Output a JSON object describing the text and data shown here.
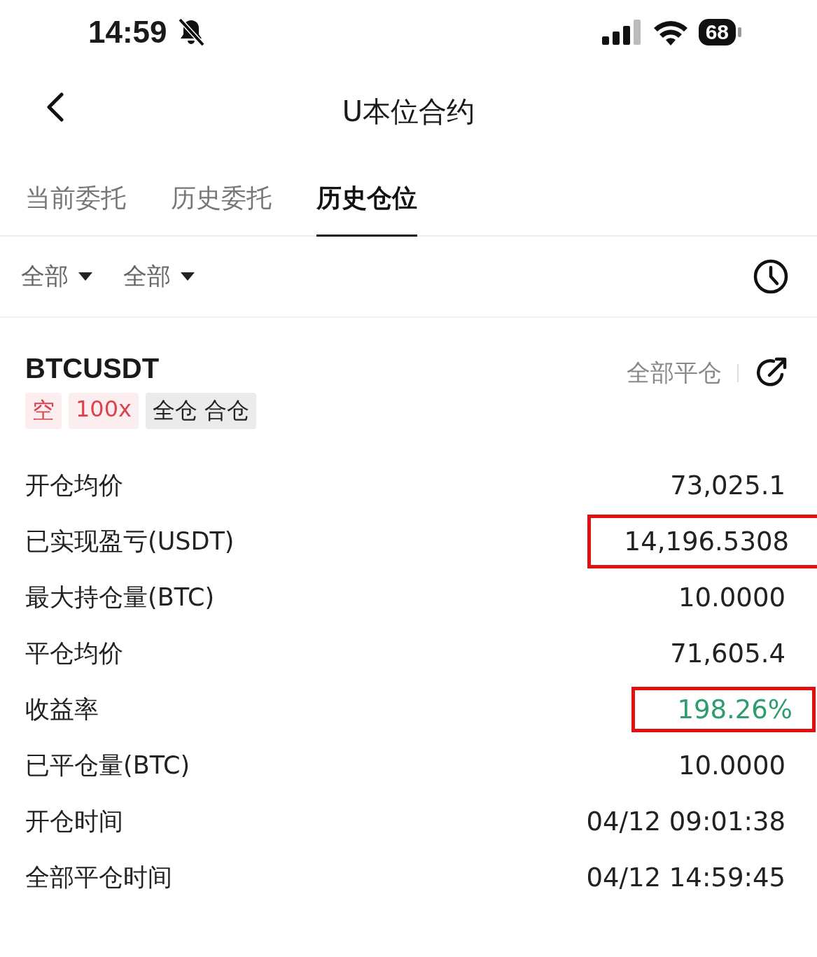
{
  "status_bar": {
    "time": "14:59",
    "battery": "68"
  },
  "header": {
    "title": "U本位合约"
  },
  "tabs": [
    {
      "label": "当前委托",
      "selected": false
    },
    {
      "label": "历史委托",
      "selected": false
    },
    {
      "label": "历史仓位",
      "selected": true
    }
  ],
  "filters": [
    {
      "label": "全部"
    },
    {
      "label": "全部"
    }
  ],
  "position": {
    "symbol": "BTCUSDT",
    "close_all": "全部平仓",
    "tags": [
      {
        "label": "空",
        "color": "#d9434f"
      },
      {
        "label": "100x",
        "color": "#d9434f"
      },
      {
        "label": "全仓 合仓",
        "color": "#222222"
      }
    ],
    "rows": [
      {
        "label": "开仓均价",
        "value": "73,025.1",
        "highlighted": false,
        "positive": false
      },
      {
        "label": "已实现盈亏(USDT)",
        "value": "14,196.5308",
        "highlighted": true,
        "positive": false
      },
      {
        "label": "最大持仓量(BTC)",
        "value": "10.0000",
        "highlighted": false,
        "positive": false
      },
      {
        "label": "平仓均价",
        "value": "71,605.4",
        "highlighted": false,
        "positive": false
      },
      {
        "label": "收益率",
        "value": "198.26%",
        "highlighted": true,
        "positive": true
      },
      {
        "label": "已平仓量(BTC)",
        "value": "10.0000",
        "highlighted": false,
        "positive": false
      },
      {
        "label": "开仓时间",
        "value": "04/12 09:01:38",
        "highlighted": false,
        "positive": false
      },
      {
        "label": "全部平仓时间",
        "value": "04/12 14:59:45",
        "highlighted": false,
        "positive": false
      }
    ]
  }
}
